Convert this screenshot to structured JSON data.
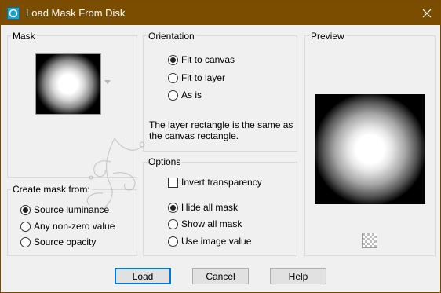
{
  "window": {
    "title": "Load Mask From Disk",
    "app_icon": "paintshop-icon",
    "close_icon": "close-icon"
  },
  "mask": {
    "label": "Mask"
  },
  "create_mask": {
    "label": "Create mask from:",
    "options": [
      {
        "label": "Source luminance",
        "checked": true
      },
      {
        "label": "Any non-zero value",
        "checked": false
      },
      {
        "label": "Source opacity",
        "checked": false
      }
    ]
  },
  "orientation": {
    "label": "Orientation",
    "options": [
      {
        "label": "Fit to canvas",
        "checked": true
      },
      {
        "label": "Fit to layer",
        "checked": false
      },
      {
        "label": "As is",
        "checked": false
      }
    ],
    "description": "The layer rectangle is the same as the canvas rectangle."
  },
  "options": {
    "label": "Options",
    "invert_label": "Invert transparency",
    "invert_checked": false,
    "radios": [
      {
        "label": "Hide all mask",
        "checked": true
      },
      {
        "label": "Show all mask",
        "checked": false
      },
      {
        "label": "Use image value",
        "checked": false
      }
    ]
  },
  "preview": {
    "label": "Preview"
  },
  "buttons": {
    "load": "Load",
    "cancel": "Cancel",
    "help": "Help"
  }
}
